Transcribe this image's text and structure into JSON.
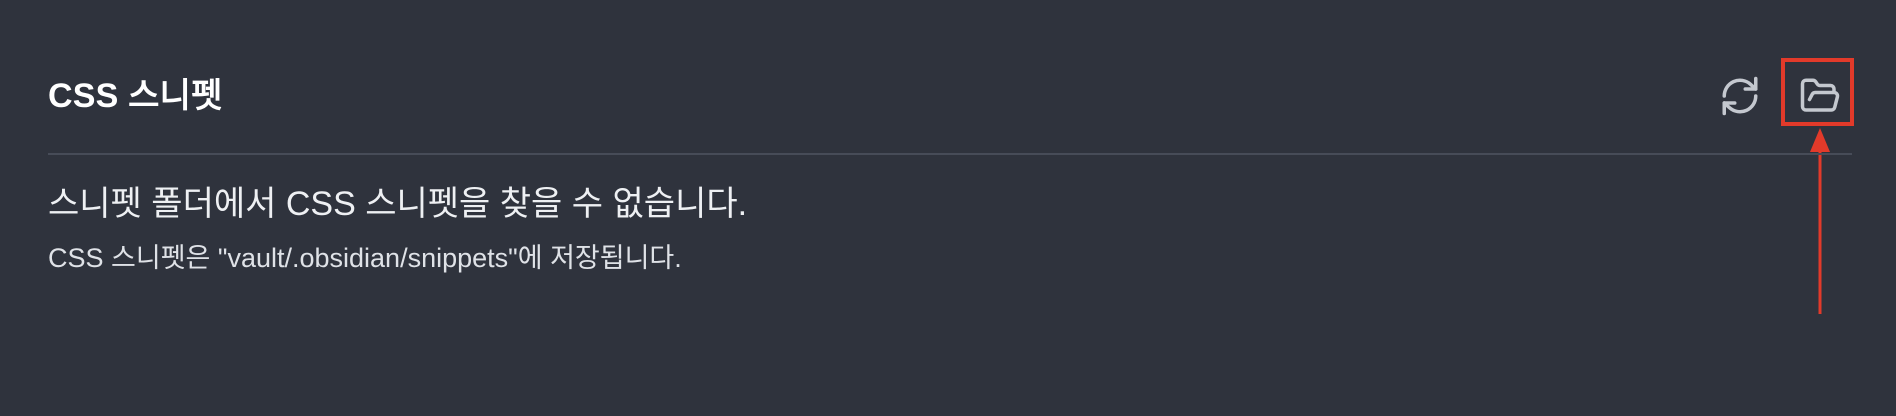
{
  "section": {
    "title": "CSS 스니펫",
    "reload_icon": "refresh-cw-icon",
    "folder_icon": "folder-open-icon"
  },
  "empty_state": {
    "message": "스니펫 폴더에서 CSS 스니펫을 찾을 수 없습니다.",
    "description": "CSS 스니펫은 \"vault/.obsidian/snippets\"에 저장됩니다."
  },
  "annotation": {
    "color": "#e23a2a"
  },
  "colors": {
    "background": "#2f333d",
    "text": "#e6e8ec",
    "divider": "#474c58",
    "icon": "#c4c8cf"
  }
}
